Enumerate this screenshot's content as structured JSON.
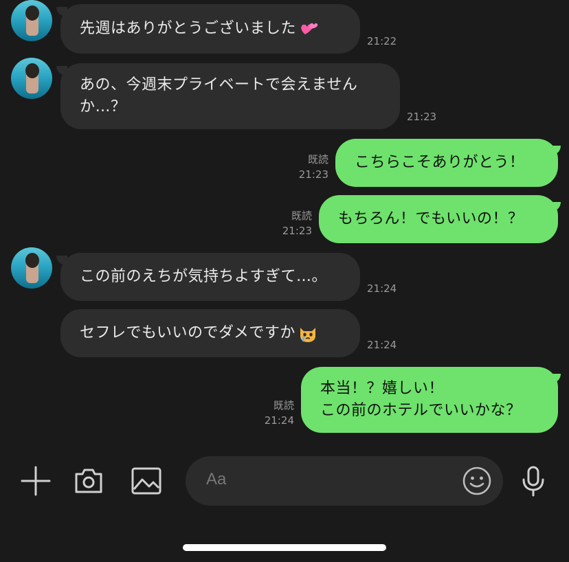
{
  "messages": [
    {
      "text": "先週はありがとうございました",
      "emoji": "💕",
      "time": "21:22"
    },
    {
      "line1": "あの、今週末プライベートで会えません",
      "line2": "か…？",
      "time": "21:23"
    },
    {
      "text": "こちらこそありがとう！",
      "read": "既読",
      "time": "21:23"
    },
    {
      "text": "もちろん！でもいいの！？",
      "read": "既読",
      "time": "21:23"
    },
    {
      "text": "この前のえちが気持ちよすぎて…。",
      "time": "21:24"
    },
    {
      "text": "セフレでもいいのでダメですか",
      "emoji": "😿",
      "time": "21:24"
    },
    {
      "line1": "本当！？嬉しい！",
      "line2": "この前のホテルでいいかな？",
      "read": "既読",
      "time": "21:24"
    }
  ],
  "input": {
    "placeholder": "Aa"
  },
  "icons": {
    "add": "plus-icon",
    "camera": "camera-icon",
    "gallery": "image-icon",
    "emoji": "smiley-icon",
    "voice": "microphone-icon"
  },
  "colors": {
    "background": "#1a1a1a",
    "incoming_bubble": "#2d2d2d",
    "outgoing_bubble": "#6ee26c",
    "meta_text": "#9a9a9a"
  }
}
